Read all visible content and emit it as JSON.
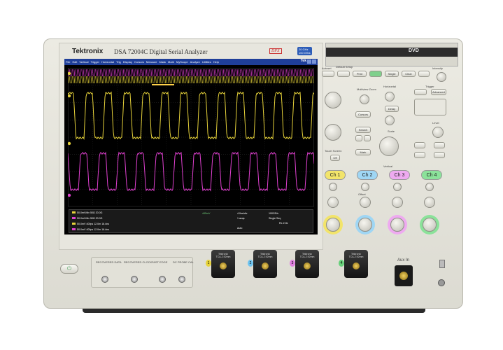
{
  "header": {
    "brand": "Tektronix",
    "model": "DSA 72004C Digital Serial Analyzer",
    "dpx_badge": "DPX",
    "spec_line1": "20 GHz",
    "spec_line2": "100 GS/s",
    "dvd_label": "DVD"
  },
  "menubar": {
    "items": [
      "File",
      "Edit",
      "Vertical",
      "Trigger",
      "Horizontal",
      "Trig",
      "Display",
      "Cursors",
      "Measure",
      "Mask",
      "Math",
      "MyScope",
      "Analyze",
      "Utilities",
      "Help"
    ],
    "tek": "Tek"
  },
  "readout": {
    "channels": [
      {
        "label": "50.0mV/div",
        "imp": "50Ω",
        "bw": "20.0G",
        "color": "#e6d23a"
      },
      {
        "label": "50.0mV/div",
        "imp": "50Ω",
        "bw": "20.0G",
        "color": "#e040d0"
      },
      {
        "label": "50.0mV 400ps",
        "imp": "12.0m",
        "bw": "16.4ns",
        "color": "#e6d23a"
      },
      {
        "label": "50.0mV 400ps",
        "imp": "12.0m",
        "bw": "16.4ns",
        "color": "#e040d0"
      }
    ],
    "trigger": "445mV",
    "timebase": "4.0ns/div",
    "samplerate": "100GS/s",
    "mode": "Single Seq",
    "acqs": "1 acqs",
    "rl": "RL:2.0k",
    "auto": "Auto"
  },
  "controls": {
    "autoset": "Autoset",
    "default_setup": "Default Setup",
    "print": "Print",
    "run_stop": "Run/Stop",
    "single": "Single",
    "clear": "Clear",
    "intensity": "Intensity",
    "multiview": "Multiview Zoom",
    "cursors": "Cursors",
    "search": "Search",
    "mark": "Mark",
    "delay": "Delay",
    "scale": "Scale",
    "position": "Position",
    "touch_screen": "Touch Screen",
    "off": "Off",
    "level": "Level",
    "advanced": "Advanced",
    "ch1": "Ch 1",
    "ch2": "Ch 2",
    "ch3": "Ch 3",
    "ch4": "Ch 4",
    "offset": "Offset",
    "vertical": "Vertical",
    "horizontal": "Horizontal",
    "trigger": "Trigger"
  },
  "front": {
    "recovered_data": "RECOVERED DATA",
    "recovered_clock": "RECOVERED CLOCK",
    "fast_edge": "FAST EDGE",
    "dc_probe_cal": "DC PROBE CAL",
    "aux_in": "Aux In",
    "probe_brand": "Tektronix",
    "probe_model": "TCA-2.92mm",
    "probe_compat": "SMA and 3.5mm Compatible",
    "ch_numbers": [
      "1",
      "2",
      "3",
      "4"
    ]
  },
  "colors": {
    "ch1": "#e6d23a",
    "ch2": "#6ec4f0",
    "ch3": "#e080e0",
    "ch4": "#66d07a"
  }
}
